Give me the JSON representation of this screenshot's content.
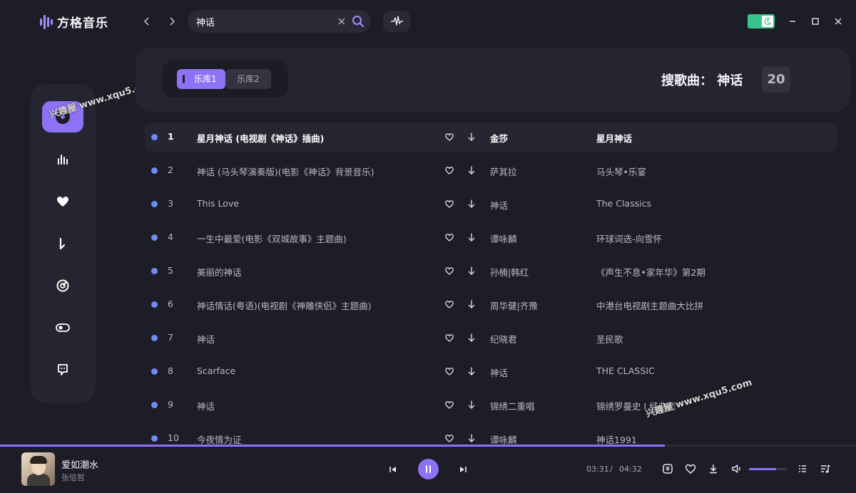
{
  "app": {
    "name": "方格音乐"
  },
  "search": {
    "value": "神话"
  },
  "tabs": [
    {
      "label": "乐库1",
      "active": true
    },
    {
      "label": "乐库2",
      "active": false
    }
  ],
  "results": {
    "label": "搜歌曲：",
    "query": "神话",
    "count": "20"
  },
  "songs": [
    {
      "num": "1",
      "title": "星月神话 (电视剧《神话》插曲)",
      "artist": "金莎",
      "album": "星月神话",
      "active": true
    },
    {
      "num": "2",
      "title": "神话 (马头琴演奏版)(电影《神话》背景音乐)",
      "artist": "萨其拉",
      "album": "马头琴•乐宴",
      "active": false
    },
    {
      "num": "3",
      "title": "This Love",
      "artist": "神话",
      "album": "The Classics",
      "active": false
    },
    {
      "num": "4",
      "title": "一生中最爱(电影《双城故事》主题曲)",
      "artist": "谭咏麟",
      "album": "环球词选-向雪怀",
      "active": false
    },
    {
      "num": "5",
      "title": "美丽的神话",
      "artist": "孙楠|韩红",
      "album": "《声生不息•家年华》第2期",
      "active": false
    },
    {
      "num": "6",
      "title": "神话情话(粤语)(电视剧《神雕侠侣》主题曲)",
      "artist": "周华健|齐豫",
      "album": "中港台电视剧主题曲大比拼",
      "active": false
    },
    {
      "num": "7",
      "title": "神话",
      "artist": "纪晓君",
      "album": "圣民歌",
      "active": false
    },
    {
      "num": "8",
      "title": "Scarface",
      "artist": "神话",
      "album": "THE CLASSIC",
      "active": false
    },
    {
      "num": "9",
      "title": "神话",
      "artist": "锦绣二重唱",
      "album": "锦绣罗曼史 I 经典恋",
      "active": false
    },
    {
      "num": "10",
      "title": "今夜情为证",
      "artist": "谭咏麟",
      "album": "神话1991",
      "active": false
    }
  ],
  "player": {
    "title": "爱如潮水",
    "artist": "张信哲",
    "current_time": "03:31",
    "separator": "/",
    "total_time": "04:32",
    "progress": 0.777,
    "volume": 0.7
  },
  "watermarks": {
    "sidebar": "兴趣屋 www.xqu5.com",
    "list": "兴趣屋 www.xqu5.com"
  },
  "colors": {
    "accent": "#8e72f5",
    "dot": "#6e8cf5",
    "toggle": "#38c48e",
    "background": "#1d1d27",
    "panel": "#252531"
  },
  "icons": {
    "sidebar": [
      "disc-icon",
      "chart-bars-icon",
      "heart-icon",
      "music-note-icon",
      "radar-icon",
      "toggle-icon",
      "chat-icon"
    ]
  }
}
